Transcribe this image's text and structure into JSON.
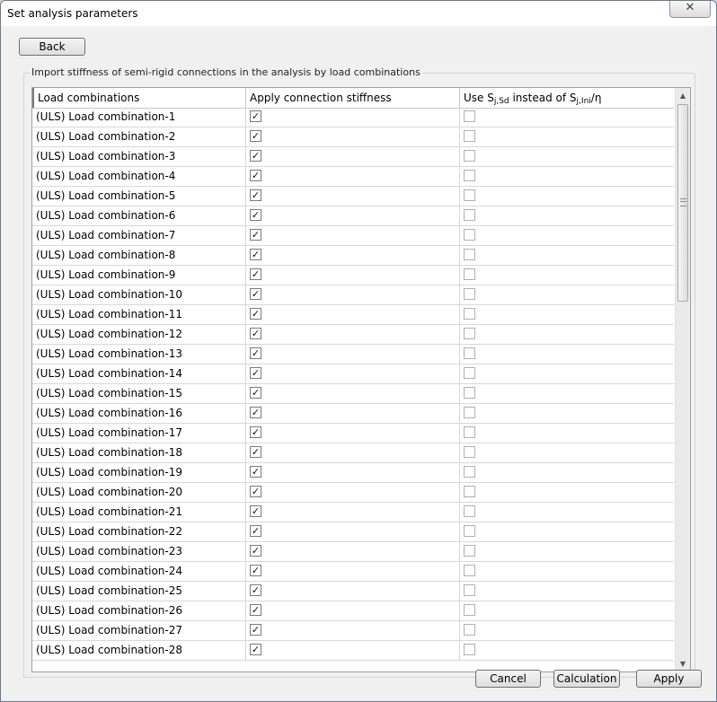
{
  "window": {
    "title": "Set analysis parameters",
    "close_glyph": "✕"
  },
  "buttons": {
    "back": "Back",
    "cancel": "Cancel",
    "calculation": "Calculation",
    "apply": "Apply"
  },
  "group": {
    "legend": "Import stiffness of semi-rigid connections in the analysis by load combinations"
  },
  "table": {
    "headers": {
      "col1": "Load combinations",
      "col2": "Apply connection stiffness",
      "col3_prefix": "Use S",
      "col3_sub1": "j,Sd",
      "col3_middle": " instead of S",
      "col3_sub2": "j,Ini",
      "col3_suffix": "/η"
    },
    "rows": [
      {
        "name": "(ULS) Load combination-1",
        "apply": true,
        "use": false
      },
      {
        "name": "(ULS) Load combination-2",
        "apply": true,
        "use": false
      },
      {
        "name": "(ULS) Load combination-3",
        "apply": true,
        "use": false
      },
      {
        "name": "(ULS) Load combination-4",
        "apply": true,
        "use": false
      },
      {
        "name": "(ULS) Load combination-5",
        "apply": true,
        "use": false
      },
      {
        "name": "(ULS) Load combination-6",
        "apply": true,
        "use": false
      },
      {
        "name": "(ULS) Load combination-7",
        "apply": true,
        "use": false
      },
      {
        "name": "(ULS) Load combination-8",
        "apply": true,
        "use": false
      },
      {
        "name": "(ULS) Load combination-9",
        "apply": true,
        "use": false
      },
      {
        "name": "(ULS) Load combination-10",
        "apply": true,
        "use": false
      },
      {
        "name": "(ULS) Load combination-11",
        "apply": true,
        "use": false
      },
      {
        "name": "(ULS) Load combination-12",
        "apply": true,
        "use": false
      },
      {
        "name": "(ULS) Load combination-13",
        "apply": true,
        "use": false
      },
      {
        "name": "(ULS) Load combination-14",
        "apply": true,
        "use": false
      },
      {
        "name": "(ULS) Load combination-15",
        "apply": true,
        "use": false
      },
      {
        "name": "(ULS) Load combination-16",
        "apply": true,
        "use": false
      },
      {
        "name": "(ULS) Load combination-17",
        "apply": true,
        "use": false
      },
      {
        "name": "(ULS) Load combination-18",
        "apply": true,
        "use": false
      },
      {
        "name": "(ULS) Load combination-19",
        "apply": true,
        "use": false
      },
      {
        "name": "(ULS) Load combination-20",
        "apply": true,
        "use": false
      },
      {
        "name": "(ULS) Load combination-21",
        "apply": true,
        "use": false
      },
      {
        "name": "(ULS) Load combination-22",
        "apply": true,
        "use": false
      },
      {
        "name": "(ULS) Load combination-23",
        "apply": true,
        "use": false
      },
      {
        "name": "(ULS) Load combination-24",
        "apply": true,
        "use": false
      },
      {
        "name": "(ULS) Load combination-25",
        "apply": true,
        "use": false
      },
      {
        "name": "(ULS) Load combination-26",
        "apply": true,
        "use": false
      },
      {
        "name": "(ULS) Load combination-27",
        "apply": true,
        "use": false
      },
      {
        "name": "(ULS) Load combination-28",
        "apply": true,
        "use": false
      }
    ]
  },
  "icons": {
    "check_glyph": "✓",
    "scroll_up_glyph": "▲",
    "scroll_down_glyph": "▼"
  }
}
